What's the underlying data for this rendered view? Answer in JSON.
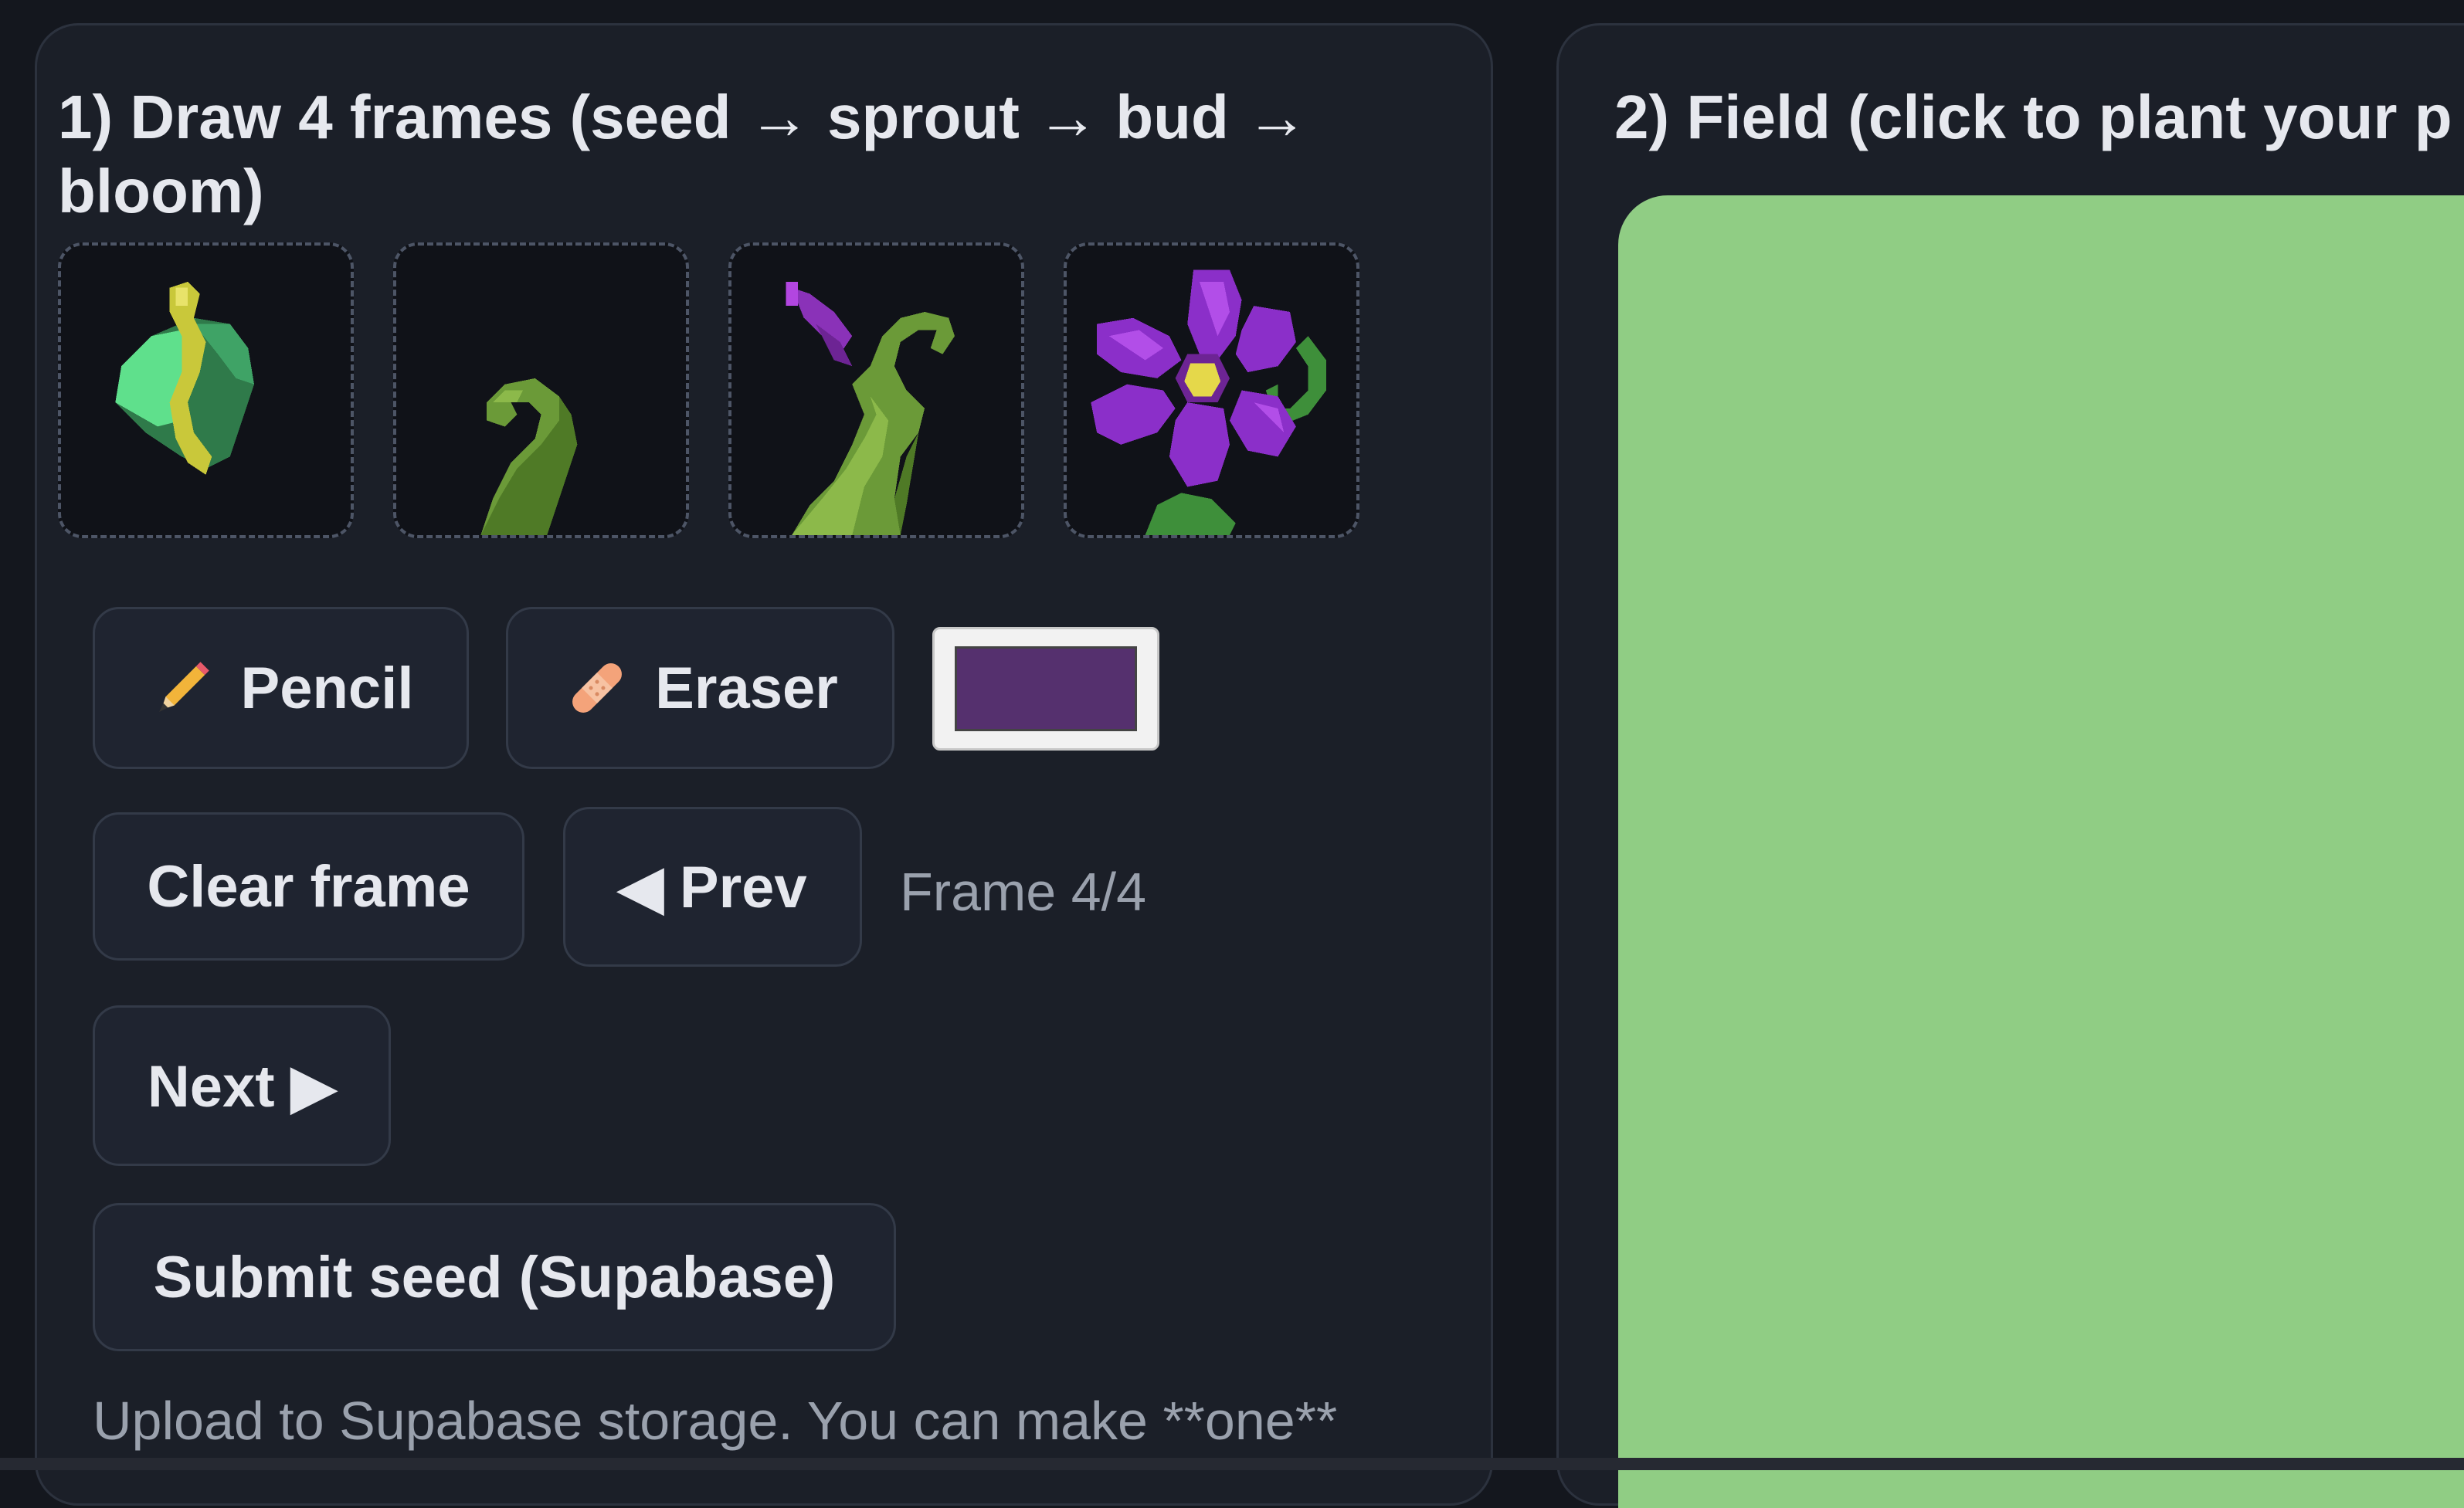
{
  "draw_panel": {
    "title": "1) Draw 4 frames (seed → sprout → bud → bloom)",
    "frames": [
      {
        "stage": "seed",
        "icon": "seed-leaf-icon"
      },
      {
        "stage": "sprout",
        "icon": "sprout-icon"
      },
      {
        "stage": "bud",
        "icon": "bud-icon"
      },
      {
        "stage": "bloom",
        "icon": "bloom-flower-icon"
      }
    ],
    "tools": {
      "pencil_label": "Pencil",
      "eraser_label": "Eraser",
      "current_color": "#55306e"
    },
    "actions": {
      "clear_label": "Clear frame",
      "prev_label": "◀ Prev",
      "next_label": "Next ▶",
      "frame_indicator": "Frame 4/4",
      "submit_label": "Submit seed (Supabase)"
    },
    "help_text": "Upload to Supabase storage. You can make **one**"
  },
  "field_panel": {
    "title": "2) Field (click to plant your p",
    "field_color": "#90cd84"
  },
  "colors": {
    "background": "#14171e",
    "panel": "#1b1f28",
    "button": "#1f2430",
    "text": "#e6e8ee",
    "muted_text": "#9aa1ad"
  }
}
